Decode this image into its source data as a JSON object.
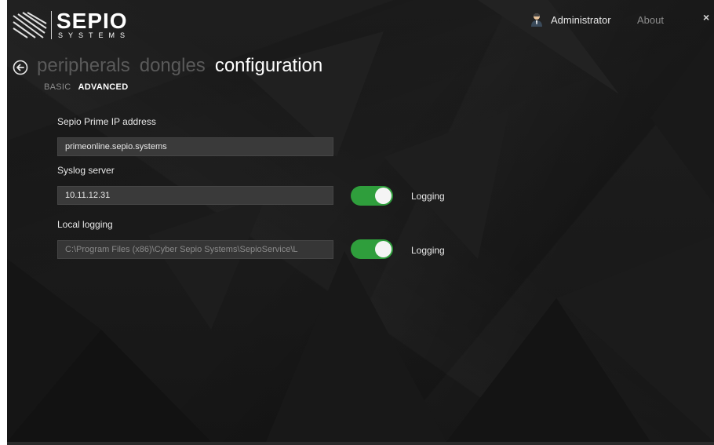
{
  "logo": {
    "name": "SEPIO",
    "sub": "SYSTEMS"
  },
  "header": {
    "user_name": "Administrator",
    "about_label": "About",
    "close_glyph": "×"
  },
  "nav": {
    "tabs": [
      {
        "label": "peripherals"
      },
      {
        "label": "dongles"
      },
      {
        "label": "configuration"
      }
    ],
    "active_tab": "configuration",
    "subtabs": [
      {
        "label": "BASIC"
      },
      {
        "label": "ADVANCED"
      }
    ],
    "active_subtab": "ADVANCED"
  },
  "form": {
    "prime_ip": {
      "label": "Sepio Prime IP address",
      "value": "primeonline.sepio.systems"
    },
    "syslog": {
      "label": "Syslog server",
      "value": "10.11.12.31",
      "toggle_on": true,
      "toggle_label": "Logging"
    },
    "local_logging": {
      "label": "Local logging",
      "value": "C:\\Program Files (x86)\\Cyber Sepio Systems\\SepioService\\L",
      "toggle_on": true,
      "toggle_label": "Logging"
    }
  },
  "colors": {
    "background": "#1c1c1c",
    "toggle_on": "#2f9e3c",
    "active_text": "#ffffff",
    "inactive_tab": "#5a5a5a",
    "field_bg": "#3a3a3a"
  }
}
